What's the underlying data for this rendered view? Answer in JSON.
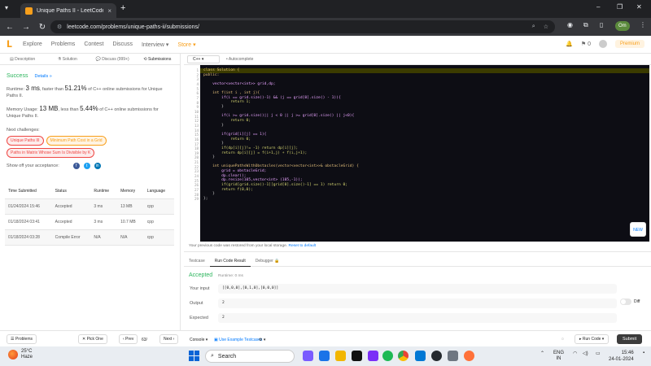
{
  "browser": {
    "tab_title": "Unique Paths II - LeetCode",
    "tab_close": "×",
    "new_tab": "+",
    "url": "leetcode.com/problems/unique-paths-ii/submissions/",
    "profile_label": "Om",
    "win_min": "–",
    "win_max": "❐",
    "win_close": "✕"
  },
  "nav": {
    "items": [
      "Explore",
      "Problems",
      "Contest",
      "Discuss",
      "Interview ▾",
      "Store ▾"
    ],
    "notif_count": "0",
    "premium_label": "Premium"
  },
  "left_tabs": [
    "Description",
    "Solution",
    "Discuss (999+)",
    "Submissions"
  ],
  "result_summary": {
    "status": "Success",
    "details_link": "Details »",
    "runtime_prefix": "Runtime: ",
    "runtime_value": "3 ms",
    "runtime_mid": ", faster than ",
    "runtime_pct": "51.21%",
    "runtime_suffix": " of C++ online submissions for Unique Paths II.",
    "memory_prefix": "Memory Usage: ",
    "memory_value": "13 MB",
    "memory_mid": ", less than ",
    "memory_pct": "5.44%",
    "memory_suffix": " of C++ online submissions for Unique Paths II.",
    "next_challenges_label": "Next challenges:",
    "challenges": [
      {
        "label": "Unique Paths III",
        "level": "hard"
      },
      {
        "label": "Minimum Path Cost in a Grid",
        "level": "med"
      },
      {
        "label": "Paths in Matrix Whose Sum Is Divisible by K",
        "level": "hard"
      }
    ],
    "share_label": "Show off your acceptance:"
  },
  "submissions": {
    "headers": [
      "Time Submitted",
      "Status",
      "Runtime",
      "Memory",
      "Language"
    ],
    "rows": [
      {
        "time": "01/24/2024 15:46",
        "status": "Accepted",
        "runtime": "3 ms",
        "memory": "13 MB",
        "language": "cpp"
      },
      {
        "time": "01/18/2024 03:41",
        "status": "Accepted",
        "runtime": "3 ms",
        "memory": "10.7 MB",
        "language": "cpp"
      },
      {
        "time": "01/18/2024 03:28",
        "status": "Compile Error",
        "runtime": "N/A",
        "memory": "N/A",
        "language": "cpp"
      }
    ]
  },
  "editor": {
    "language": "C++",
    "autocomplete_label": "• Autocomplete",
    "line_numbers": [
      "1",
      "2",
      "3",
      "4",
      "5",
      "6",
      "7",
      "8",
      "9",
      "10",
      "11",
      "12",
      "13",
      "14",
      "15",
      "16",
      "17",
      "18",
      "19",
      "20",
      "21",
      "22",
      "23",
      "24",
      "25",
      "26",
      "27",
      "28",
      "29"
    ],
    "code_lines": [
      "class Solution {",
      "public:",
      "",
      "    vector<vector<int>> grid,dp;",
      "",
      "    int f(int i , int j){",
      "        if(i == grid.size()-1) && (j == grid[0].size() - 1)){",
      "            return 1;",
      "        }",
      "",
      "        if(i >= grid.size()|| j < 0 || j >= grid[0].size() || j<0){",
      "            return 0;",
      "        }",
      "",
      "        if(grid[i][j] == 1){",
      "            return 0;",
      "        }",
      "        if(dp[i][j]!= -1) return dp[i][j];",
      "        return dp[i][j] = f(i+1,j) + f(i,j+1);",
      "    }",
      "",
      "    int uniquePathsWithObstacles(vector<vector<int>>& obstacleGrid) {",
      "        grid = obstacleGrid;",
      "        dp.clear();",
      "        dp.resize(105,vector<int> (105,-1));",
      "        if(grid[grid.size()-1][grid[0].size()-1] == 1) return 0;",
      "        return f(0,0);",
      "    }",
      "};"
    ],
    "new_badge": "NEW"
  },
  "console": {
    "restored_text": "Your previous code was restored from your local storage. ",
    "reset_link": "Reset to default",
    "tabs": [
      "Testcase",
      "Run Code Result",
      "Debugger 🔒"
    ],
    "result_status": "Accepted",
    "runtime_text": "Runtime: 0 ms",
    "input_label": "Your input",
    "input_value": "[[0,0,0],[0,1,0],[0,0,0]]",
    "output_label": "Output",
    "output_value": "2",
    "expected_label": "Expected",
    "expected_value": "2",
    "diff_label": "Diff"
  },
  "bottom": {
    "problems": "☰ Problems",
    "pick_one": "✕ Pick One",
    "prev": "‹ Prev",
    "page": "63/",
    "next": "Next ›",
    "console": "Console ▾",
    "use_example": "Use Example Testcases",
    "run_code": "▸ Run Code ▾",
    "submit": "Submit"
  },
  "taskbar": {
    "temp": "25°C",
    "weather": "Haze",
    "search_placeholder": "Search",
    "lang_top": "ENG",
    "lang_bottom": "IN",
    "time": "15:46",
    "date": "24-01-2024"
  },
  "colors": {
    "accent_orange": "#f89f1b",
    "success_green": "#2db55d",
    "error_red": "#ef4743",
    "link_blue": "#007aff",
    "editor_bg": "#0d0d14"
  }
}
